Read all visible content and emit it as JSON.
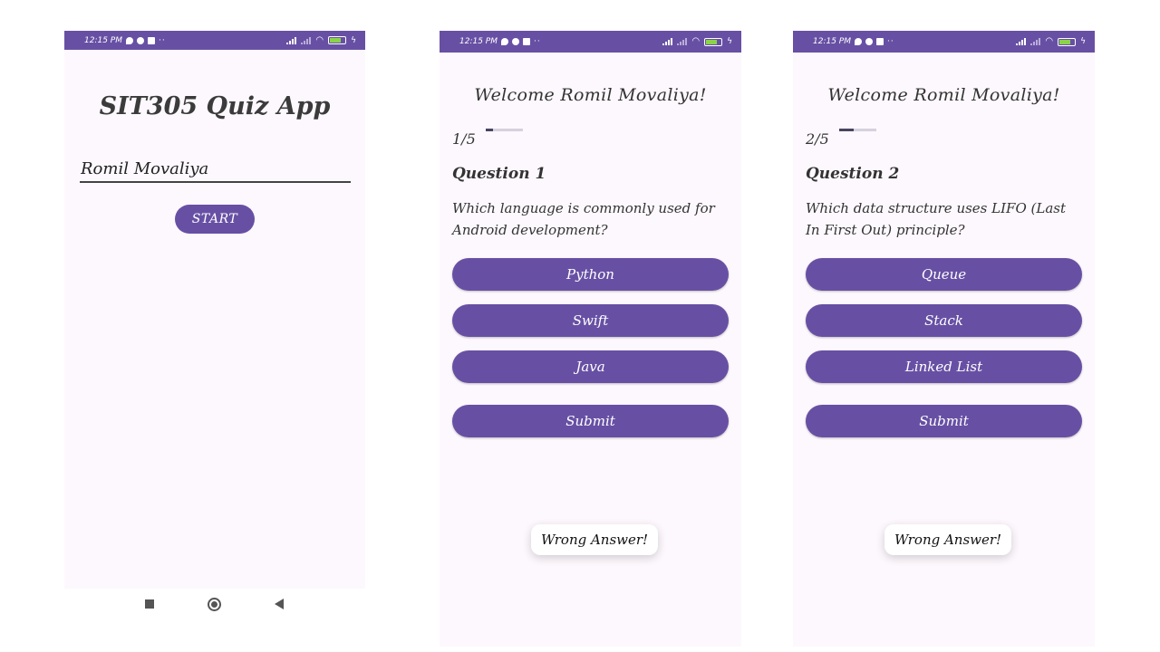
{
  "status_bar": {
    "time": "12:15 PM",
    "battery": "85"
  },
  "screen1": {
    "title": "SIT305 Quiz App",
    "name_input_value": "Romil Movaliya",
    "start_label": "START"
  },
  "screen2": {
    "welcome": "Welcome Romil Movaliya!",
    "progress_text": "1/5",
    "progress_fraction": 0.2,
    "question_title": "Question 1",
    "question_text": "Which language is commonly used for Android development?",
    "options": [
      "Python",
      "Swift",
      "Java"
    ],
    "submit_label": "Submit",
    "toast": "Wrong Answer!"
  },
  "screen3": {
    "welcome": "Welcome Romil Movaliya!",
    "progress_text": "2/5",
    "progress_fraction": 0.4,
    "question_title": "Question 2",
    "question_text": "Which data structure uses LIFO (Last In First Out) principle?",
    "options": [
      "Queue",
      "Stack",
      "Linked List"
    ],
    "submit_label": "Submit",
    "toast": "Wrong Answer!"
  },
  "colors": {
    "primary": "#6750a4",
    "background": "#fdf8fd",
    "progress_track": "#d6d1de",
    "progress_fill": "#4a4360"
  },
  "icons": [
    "message-icon",
    "app-icon",
    "linkedin-icon",
    "signal-icon",
    "wifi-icon",
    "battery-icon",
    "charging-icon",
    "recents-icon",
    "home-icon",
    "back-icon"
  ]
}
